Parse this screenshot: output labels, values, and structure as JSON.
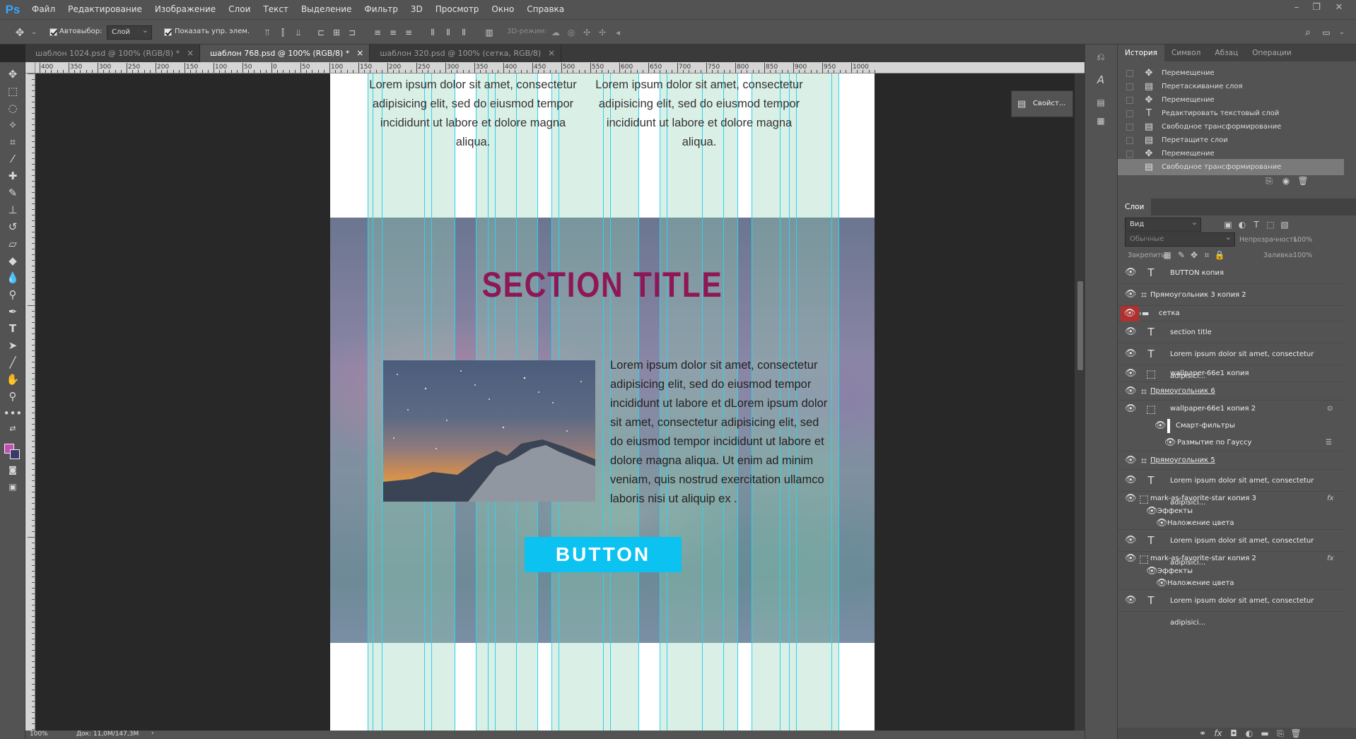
{
  "app": {
    "logo": "Ps"
  },
  "menu": [
    "Файл",
    "Редактирование",
    "Изображение",
    "Слои",
    "Текст",
    "Выделение",
    "Фильтр",
    "3D",
    "Просмотр",
    "Окно",
    "Справка"
  ],
  "options": {
    "autoselect_label": "Автовыбор:",
    "autoselect_value": "Слой",
    "show_transform_label": "Показать упр. элем.",
    "mode3d_label": "3D-режим:"
  },
  "tabs": [
    {
      "label": "шаблон 1024.psd @ 100% (RGB/8) *"
    },
    {
      "label": "шаблон 768.psd @ 100% (RGB/8) *",
      "active": true
    },
    {
      "label": "шаблон 320.psd @ 100% (сетка, RGB/8)"
    }
  ],
  "ruler_labels": [
    "400",
    "350",
    "300",
    "250",
    "200",
    "150",
    "100",
    "50",
    "0",
    "50",
    "100",
    "150",
    "200",
    "250",
    "300",
    "350",
    "400",
    "450",
    "500",
    "550",
    "600",
    "650",
    "700",
    "750",
    "800",
    "850",
    "900",
    "950",
    "1000"
  ],
  "document": {
    "top_left_text": "Lorem ipsum dolor sit amet, consectetur adipisicing elit, sed do eiusmod tempor incididunt ut labore et dolore magna aliqua.",
    "top_right_text": "Lorem ipsum dolor sit amet, consectetur adipisicing elit, sed do eiusmod tempor incididunt ut labore et dolore magna aliqua.",
    "section_title": "SECTION TITLE",
    "body_text": "Lorem ipsum dolor sit amet, consectetur adipisicing elit, sed do eiusmod tempor incididunt ut labore et dLorem ipsum dolor sit amet, consectetur adipisicing elit, sed do eiusmod tempor incididunt ut labore et dolore magna aliqua. Ut enim ad minim veniam, quis nostrud exercitation ullamco laboris nisi ut aliquip ex .",
    "button_label": "BUTTON",
    "title_color": "#8e1856",
    "button_color": "#0bc2f1"
  },
  "mini_panel": {
    "label": "Свойст..."
  },
  "status": {
    "zoom": "100%",
    "doc_size": "Док: 11,0M/147,3M"
  },
  "history_panel": {
    "tabs": [
      "История",
      "Символ",
      "Абзац",
      "Операции"
    ],
    "items": [
      {
        "icon": "move-icon",
        "label": "Перемещение"
      },
      {
        "icon": "doc-icon",
        "label": "Перетаскивание слоя"
      },
      {
        "icon": "move-icon",
        "label": "Перемещение"
      },
      {
        "icon": "text-icon",
        "label": "Редактировать текстовый слой"
      },
      {
        "icon": "doc-icon",
        "label": "Свободное трансформирование"
      },
      {
        "icon": "doc-icon",
        "label": "Перетащите слои"
      },
      {
        "icon": "move-icon",
        "label": "Перемещение"
      },
      {
        "icon": "doc-icon",
        "label": "Свободное трансформирование",
        "selected": true
      }
    ]
  },
  "layers_panel": {
    "title": "Слои",
    "filter_value": "Вид",
    "blend_mode": "Обычные",
    "opacity_label": "Непрозрачность:",
    "opacity_value": "100%",
    "lock_label": "Закрепить:",
    "fill_label": "Заливка:",
    "fill_value": "100%",
    "layers": [
      {
        "type": "text",
        "name": "BUTTON копия"
      },
      {
        "type": "shape",
        "name": "Прямоугольник 3 копия 2"
      },
      {
        "type": "folder",
        "name": "сетка",
        "eye_red": true
      },
      {
        "type": "text",
        "name": "section title"
      },
      {
        "type": "text",
        "name": "Lorem ipsum dolor sit amet, consectetur adipisici..."
      },
      {
        "type": "smart",
        "name": "wallpaper-66e1 копия"
      },
      {
        "type": "shape",
        "name": "Прямоугольник 6",
        "underline": true
      },
      {
        "type": "smart",
        "name": "wallpaper-66e1 копия 2"
      },
      {
        "type": "sub",
        "name": "Смарт-фильтры"
      },
      {
        "type": "sub2",
        "name": "Размытие по Гауссу"
      },
      {
        "type": "shape",
        "name": "Прямоугольник 5",
        "underline": true
      },
      {
        "type": "text",
        "name": "Lorem ipsum dolor sit amet, consectetur adipisici..."
      },
      {
        "type": "smart",
        "name": "mark-as-favorite-star копия 3",
        "fx": true
      },
      {
        "type": "sub",
        "name": "Эффекты"
      },
      {
        "type": "sub2",
        "name": "Наложение цвета"
      },
      {
        "type": "text",
        "name": "Lorem ipsum dolor sit amet, consectetur adipisici..."
      },
      {
        "type": "smart",
        "name": "mark-as-favorite-star копия 2",
        "fx": true
      },
      {
        "type": "sub",
        "name": "Эффекты"
      },
      {
        "type": "sub2",
        "name": "Наложение цвета"
      },
      {
        "type": "text",
        "name": "Lorem ipsum dolor sit amet, consectetur adipisici..."
      }
    ]
  }
}
